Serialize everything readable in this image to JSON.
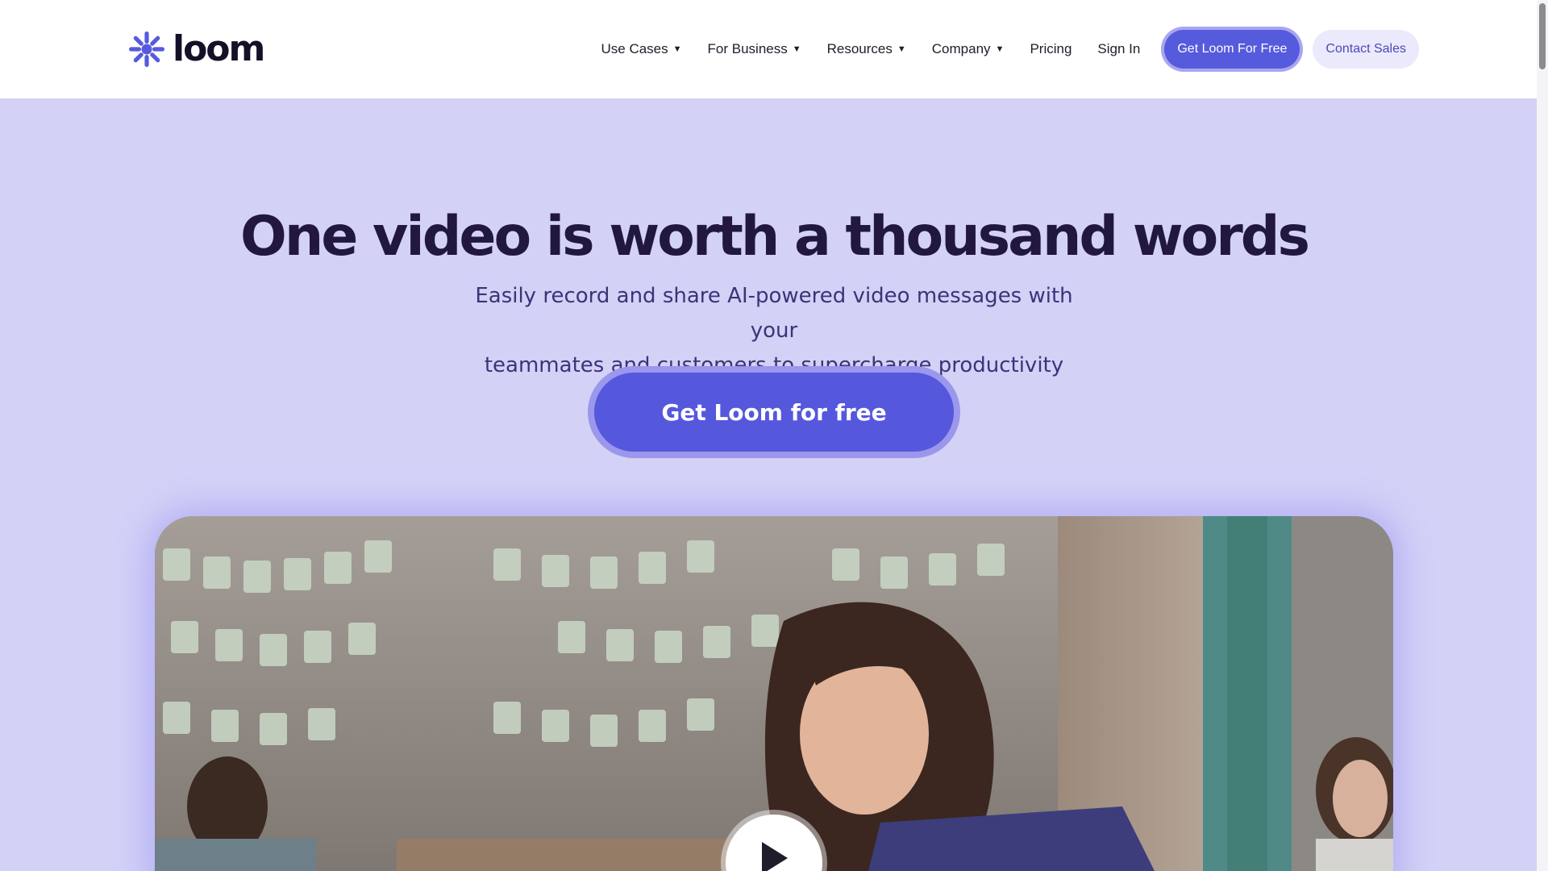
{
  "brand": {
    "name": "loom",
    "accent_color": "#565add"
  },
  "nav": {
    "items": [
      {
        "label": "Use Cases",
        "has_dropdown": true
      },
      {
        "label": "For Business",
        "has_dropdown": true
      },
      {
        "label": "Resources",
        "has_dropdown": true
      },
      {
        "label": "Company",
        "has_dropdown": true
      },
      {
        "label": "Pricing",
        "has_dropdown": false
      },
      {
        "label": "Sign In",
        "has_dropdown": false
      }
    ],
    "primary_button": "Get Loom For Free",
    "secondary_button": "Contact Sales"
  },
  "hero": {
    "title": "One video is worth a thousand words",
    "subtitle_line1": "Easily record and share AI-powered video messages with your",
    "subtitle_line2": "teammates and customers to supercharge productivity",
    "cta_label": "Get Loom for free"
  },
  "video": {
    "icon": "play-icon"
  }
}
